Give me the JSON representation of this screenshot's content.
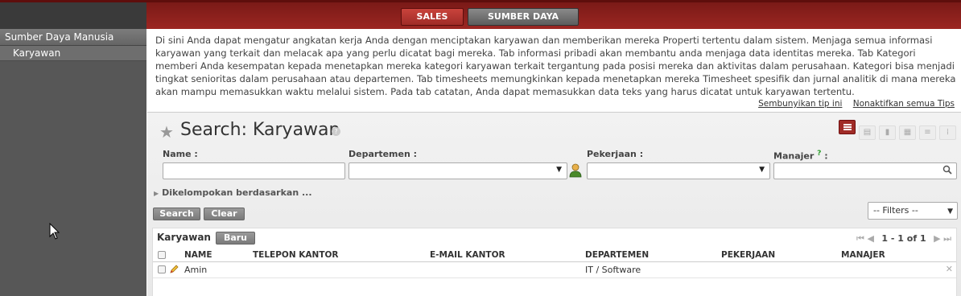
{
  "topmenu": {
    "sales": "SALES",
    "hr": "SUMBER DAYA MANUSIA"
  },
  "sidebar": {
    "heading": "Sumber Daya Manusia",
    "items": [
      {
        "label": "Karyawan"
      }
    ]
  },
  "tip": {
    "text": "Di sini Anda dapat mengatur angkatan kerja Anda dengan menciptakan karyawan dan memberikan mereka Properti tertentu dalam sistem. Menjaga semua informasi karyawan yang terkait dan melacak apa yang perlu dicatat bagi mereka. Tab informasi pribadi akan membantu anda menjaga data identitas mereka. Tab Kategori memberi Anda kesempatan kepada menetapkan mereka kategori karyawan terkait tergantung pada posisi mereka dan aktivitas dalam perusahaan. Kategori bisa menjadi tingkat senioritas dalam perusahaan atau departemen. Tab timesheets memungkinkan kepada menetapkan mereka Timesheet spesifik dan jurnal analitik di mana mereka akan mampu memasukkan waktu melalui sistem. Pada tab catatan, Anda dapat memasukkan data teks yang harus dicatat untuk karyawan tertentu.",
    "hide_link": "Sembunyikan tip ini",
    "disable_link": "Nonaktifkan semua Tips"
  },
  "search": {
    "title": "Search: Karyawan",
    "help": "?",
    "fields": {
      "name": {
        "label": "Name",
        "value": ""
      },
      "department": {
        "label": "Departemen",
        "value": ""
      },
      "job": {
        "label": "Pekerjaan",
        "value": ""
      },
      "manager": {
        "label": "Manajer",
        "help": "?",
        "value": ""
      }
    },
    "colon": ":",
    "group_by": "Dikelompokan berdasarkan ...",
    "search_button": "Search",
    "clear_button": "Clear",
    "filters_select": "-- Filters --"
  },
  "list": {
    "title": "Karyawan",
    "new_button": "Baru",
    "pager": "1 - 1 of 1",
    "columns": [
      "NAME",
      "TELEPON KANTOR",
      "E-MAIL KANTOR",
      "DEPARTEMEN",
      "PEKERJAAN",
      "MANAJER"
    ],
    "rows": [
      {
        "name": "Amin",
        "phone": "",
        "email": "",
        "department": "IT / Software",
        "job": "",
        "manager": ""
      }
    ]
  },
  "colors": {
    "brand_red": "#a02b27",
    "sidebar_bg": "#575757"
  }
}
